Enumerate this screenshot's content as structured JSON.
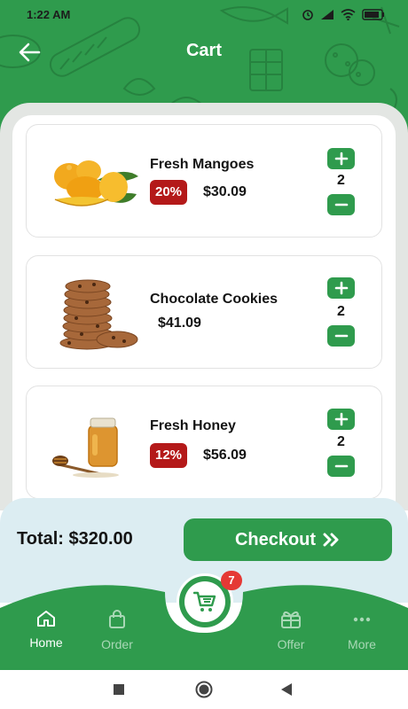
{
  "status_bar": {
    "time": "1:22 AM",
    "icons": [
      "alarm-icon",
      "signal-icon",
      "wifi-icon",
      "battery-icon"
    ]
  },
  "header": {
    "title": "Cart",
    "back_icon": "arrow-left-icon"
  },
  "cart": {
    "items": [
      {
        "name": "Fresh Mangoes",
        "discount": "20%",
        "price": "$30.09",
        "quantity": "2",
        "image": "mango-image"
      },
      {
        "name": "Chocolate Cookies",
        "discount": "",
        "price": "$41.09",
        "quantity": "2",
        "image": "cookies-image"
      },
      {
        "name": "Fresh Honey",
        "discount": "12%",
        "price": "$56.09",
        "quantity": "2",
        "image": "honey-image"
      }
    ]
  },
  "checkout": {
    "total_label": "Total: $320.00",
    "button_label": "Checkout",
    "button_icon": "double-chevron-right-icon"
  },
  "bottom_nav": {
    "items": [
      {
        "label": "Home",
        "icon": "home-icon",
        "active": true
      },
      {
        "label": "Order",
        "icon": "shopping-bag-icon",
        "active": false
      },
      {
        "label": "Offer",
        "icon": "gift-icon",
        "active": false
      },
      {
        "label": "More",
        "icon": "more-dots-icon",
        "active": false
      }
    ],
    "cart_icon": "cart-icon",
    "cart_badge": "7"
  },
  "system_nav": [
    "recents-square-icon",
    "home-circle-icon",
    "back-triangle-icon"
  ],
  "colors": {
    "primary_green": "#2f9b4d",
    "discount_red": "#b41919",
    "badge_red": "#e53935",
    "checkout_bar_bg": "#dcedf2",
    "panel_bg": "#e3e6e3"
  }
}
